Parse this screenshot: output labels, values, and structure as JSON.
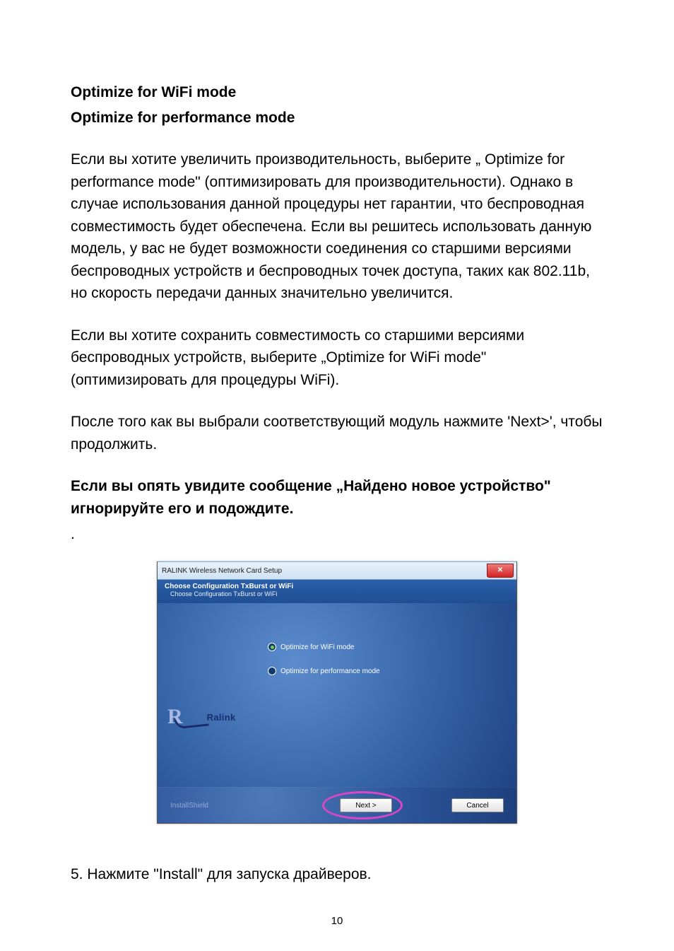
{
  "headings": {
    "line1": "Optimize for WiFi mode",
    "line2": "Optimize for performance mode"
  },
  "paragraph1": "Если вы хотите увеличить производительность, выберите „ Optimize for performance mode\" (оптимизировать для производительности). Однако в случае использования данной процедуры нет гарантии, что беспроводная совместимость будет обеспечена. Если вы решитесь использовать данную модель, у вас не будет возможности соединения со старшими версиями беспроводных устройств и беспроводных точек доступа, таких как 802.11b, но скорость передачи данных значительно увеличится.",
  "paragraph2": "Если вы хотите сохранить совместимость со старшими версиями беспроводных устройств, выберите „Optimize for WiFi mode\" (оптимизировать для процедуры  WiFi).",
  "paragraph3": "После того как вы выбрали соответствующий модуль нажмите 'Next>', чтобы продолжить.",
  "bold_notice": "Если вы опять увидите сообщение „Найдено новое устройство\" игнорируйте его и подождите.",
  "dot": ".",
  "dialog": {
    "title": "RALINK Wireless Network Card Setup",
    "close": "✕",
    "banner_title": "Choose Configuration TxBurst or WiFi",
    "banner_sub": "Choose Configuration TxBurst or WiFi",
    "logo_text": "Ralink",
    "radio1": "Optimize for WiFi mode",
    "radio2": "Optimize for performance mode",
    "installshield": "InstallShield",
    "next_btn": "Next >",
    "cancel_btn": "Cancel"
  },
  "step5": "5. Нажмите \"Install\" для запуска драйверов.",
  "page_number": "10"
}
